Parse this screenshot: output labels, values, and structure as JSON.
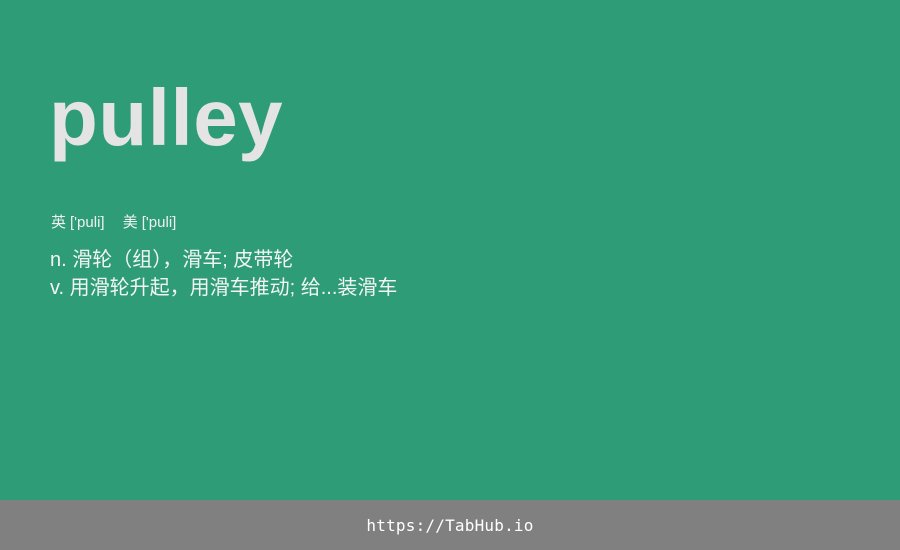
{
  "card": {
    "word": "pulley",
    "phonetics": {
      "uk_label": "英",
      "uk": "['puli]",
      "us_label": "美",
      "us": "['puli]"
    },
    "definitions": [
      "n. 滑轮（组），滑车; 皮带轮",
      "v. 用滑轮升起，用滑车推动; 给...装滑车"
    ],
    "background_color": "#2e9c76"
  },
  "footer": {
    "link_text": "https://TabHub.io",
    "background_color": "#808080"
  }
}
